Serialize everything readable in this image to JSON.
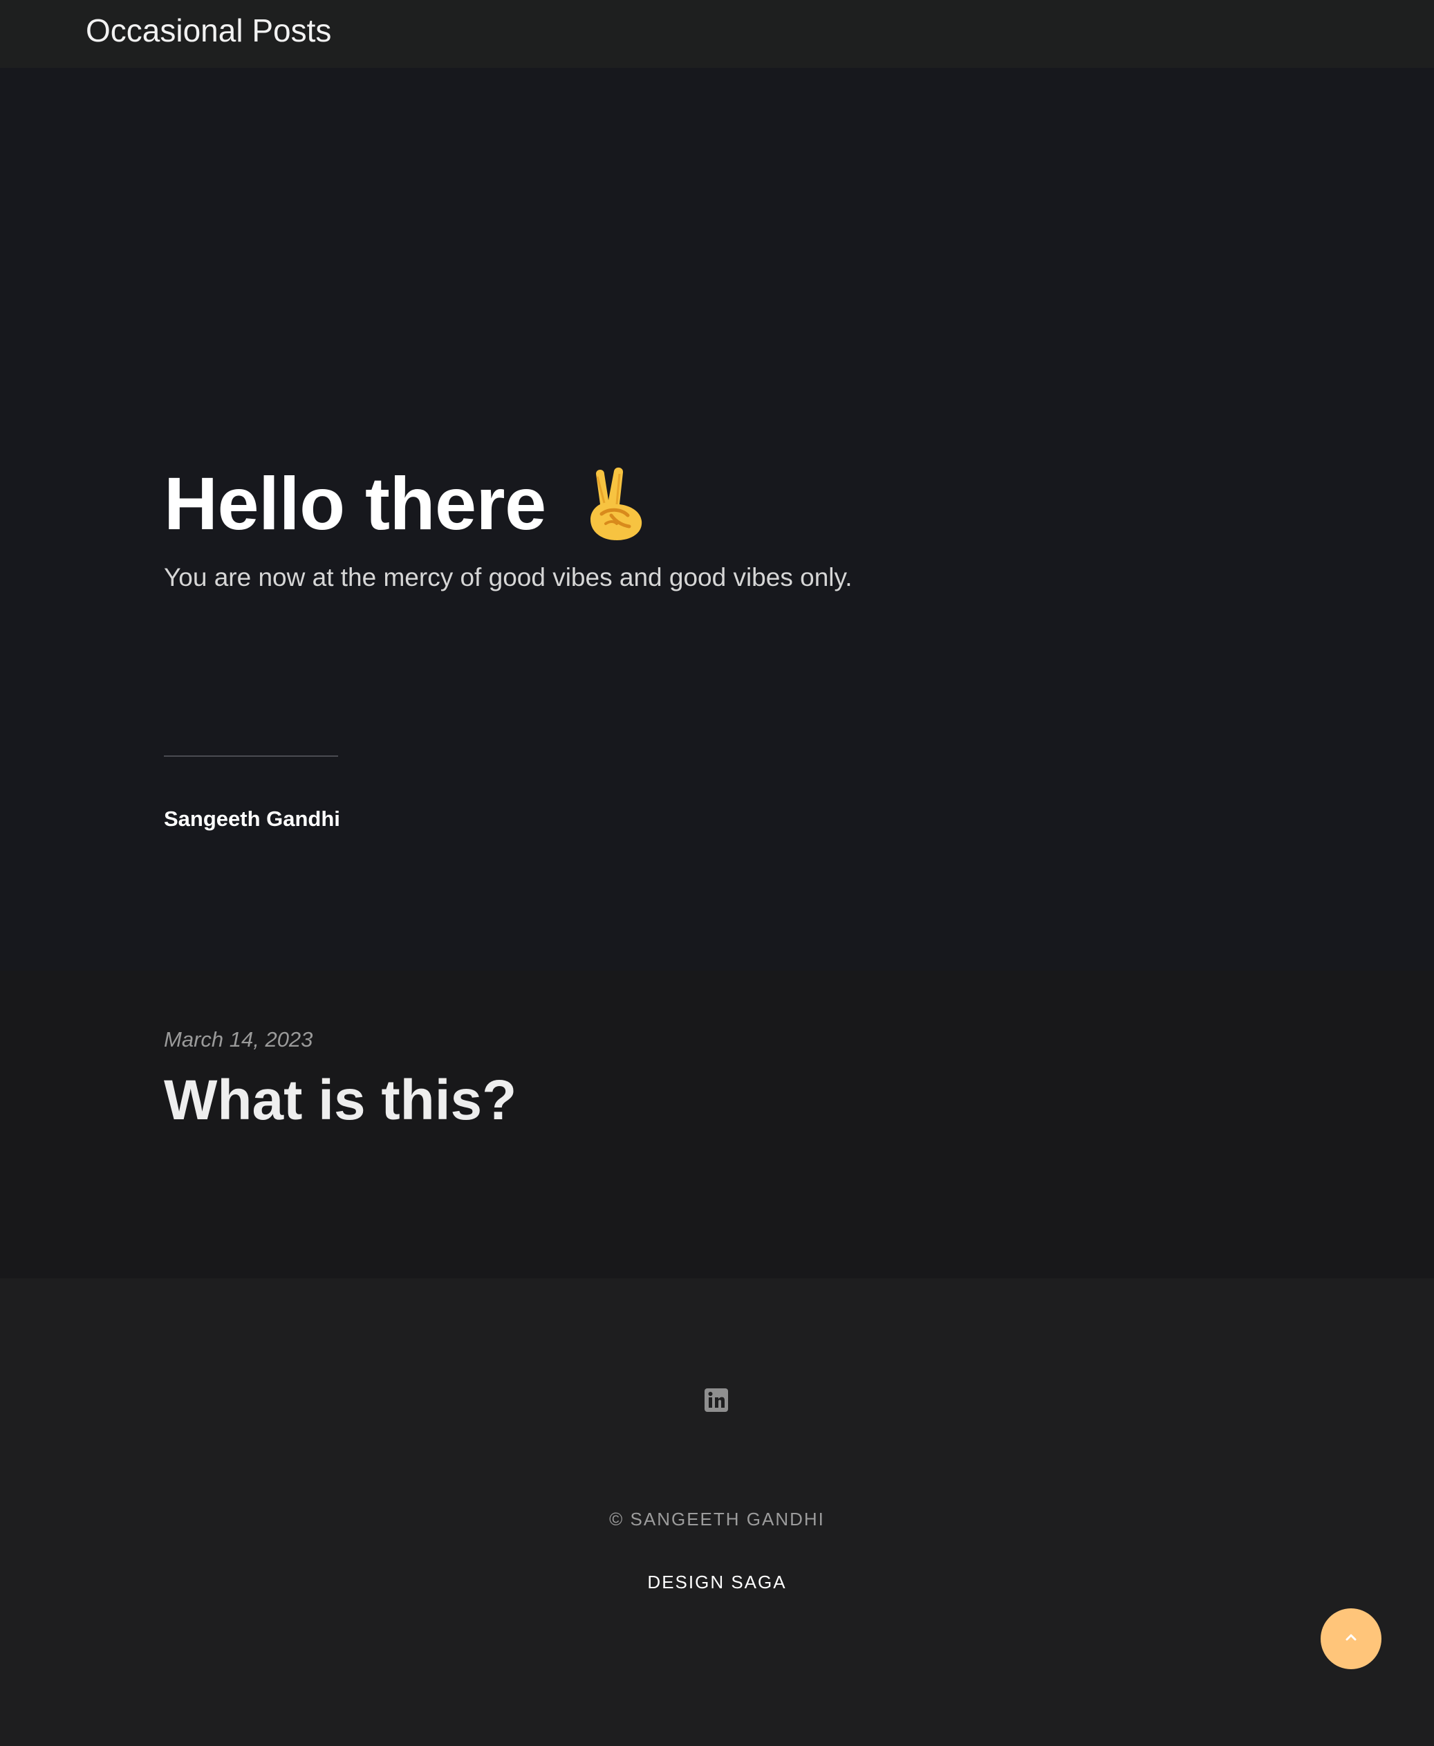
{
  "header": {
    "brand": "Occasional Posts"
  },
  "hero": {
    "title": "Hello there",
    "emoji_icon": "victory-hand-icon",
    "subtitle": "You are now at the mercy of good vibes and good vibes only.",
    "author": "Sangeeth Gandhi"
  },
  "posts": [
    {
      "date": "March 14, 2023",
      "title": "What is this?"
    }
  ],
  "footer": {
    "social": [
      {
        "icon": "linkedin-icon"
      }
    ],
    "copyright": "© SANGEETH GANDHI",
    "credit": "DESIGN SAGA"
  },
  "scroll_top": {
    "icon": "chevron-up-icon"
  },
  "colors": {
    "hero_bg": "#17181d",
    "posts_bg": "#18181a",
    "footer_bg": "#1e1e1f",
    "accent": "#ffc57a",
    "emoji_yellow": "#f7c341"
  }
}
